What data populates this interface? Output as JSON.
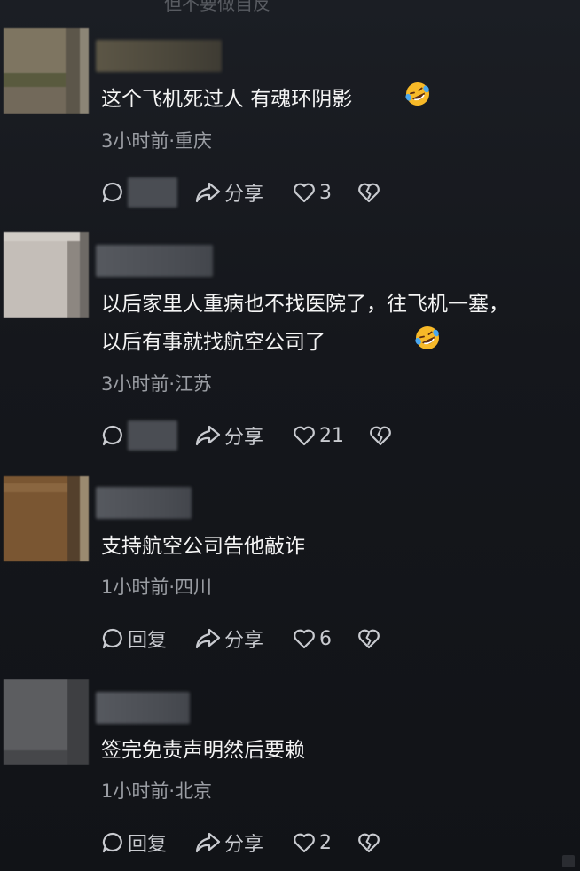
{
  "header_fragment": "但不要做自反",
  "comments": [
    {
      "text": "这个飞机死过人  有魂环阴影",
      "meta": "3小时前·重庆",
      "reply_label": "",
      "share_label": "分享",
      "likes": "3"
    },
    {
      "text": "以后家里人重病也不找医院了，往飞机一塞，以后有事就找航空公司了",
      "meta": "3小时前·江苏",
      "reply_label": "",
      "share_label": "分享",
      "likes": "21"
    },
    {
      "text": "支持航空公司告他敲诈",
      "meta": "1小时前·四川",
      "reply_label": "回复",
      "share_label": "分享",
      "likes": "6"
    },
    {
      "text": "签完免责声明然后要赖",
      "meta": "1小时前·北京",
      "reply_label": "回复",
      "share_label": "分享",
      "likes": "2"
    }
  ],
  "icons": {
    "reply": "comment-bubble-icon",
    "share": "share-arrow-icon",
    "like": "heart-icon",
    "dislike": "broken-heart-icon",
    "emoji": "rofl-emoji-icon"
  },
  "colors": {
    "background": "#15171c",
    "text": "#f4f4f4",
    "meta": "#9a9da3",
    "icon": "#c9cbd0"
  }
}
